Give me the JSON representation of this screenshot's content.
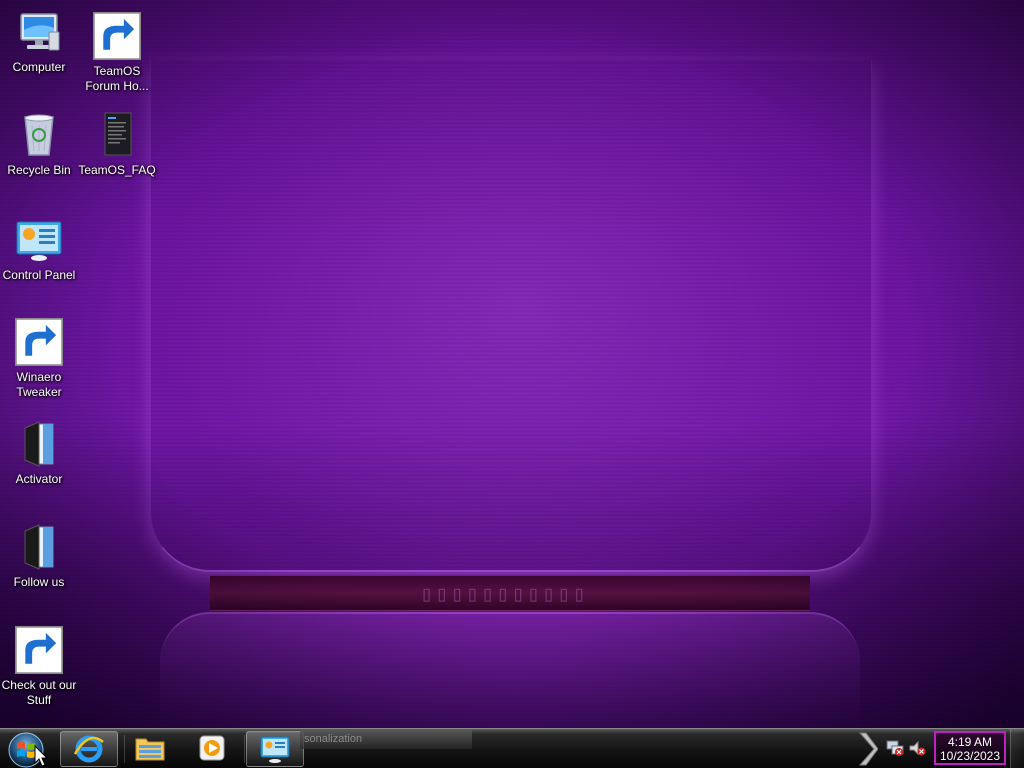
{
  "desktop": {
    "icons": [
      {
        "label": "Computer",
        "icon": "computer-icon"
      },
      {
        "label": "TeamOS Forum Ho...",
        "icon": "star-icon"
      },
      {
        "label": "Recycle Bin",
        "icon": "recycle-bin-icon"
      },
      {
        "label": "TeamOS_FAQ",
        "icon": "document-icon"
      },
      {
        "label": "Control Panel",
        "icon": "control-panel-icon"
      },
      {
        "label": "Winaero Tweaker",
        "icon": "winaero-tweaker-icon"
      },
      {
        "label": "Activator",
        "icon": "activator-icon"
      },
      {
        "label": "Follow us",
        "icon": "follow-us-icon"
      },
      {
        "label": "Check out our Stuff",
        "icon": "globe-icon"
      }
    ]
  },
  "taskbar": {
    "pinned": [
      {
        "name": "internet-explorer",
        "icon": "internet-explorer-icon"
      },
      {
        "name": "file-explorer",
        "icon": "folder-icon"
      },
      {
        "name": "media-player",
        "icon": "media-player-icon"
      },
      {
        "name": "personalization-window",
        "icon": "personalization-icon"
      }
    ],
    "window_preview_text": "sonalization",
    "clock": {
      "time": "4:19 AM",
      "date": "10/23/2023"
    }
  },
  "colors": {
    "desktop_accent": "#6f18a6",
    "clock_border": "#c11fc6"
  }
}
